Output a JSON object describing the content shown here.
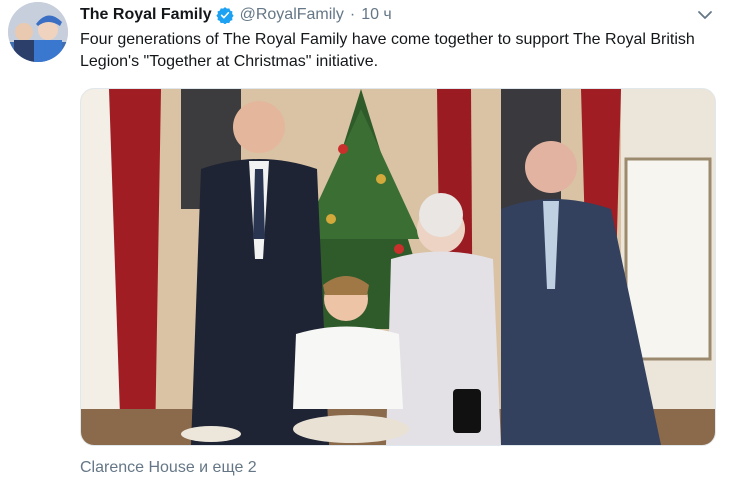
{
  "tweet": {
    "display_name": "The Royal Family",
    "verified_icon": "verified-badge-icon",
    "handle": "@RoyalFamily",
    "separator": "·",
    "time": "10 ч",
    "text": "Four generations of The Royal Family have come together to support The Royal British Legion's \"Together at Christmas\" initiative.",
    "location_text": "Clarence House и еще 2",
    "more_icon": "chevron-down-icon",
    "media_description_icon": "photo-image"
  },
  "colors": {
    "name": "#14171a",
    "secondary": "#657786",
    "verified": "#1da1f2",
    "border": "#e1e8ed"
  }
}
